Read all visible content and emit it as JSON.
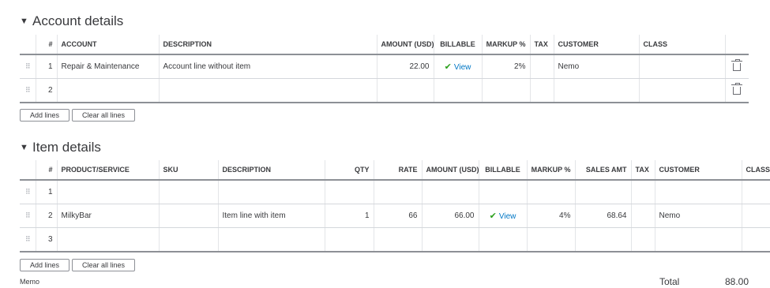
{
  "account_section": {
    "title": "Account details",
    "columns": [
      "#",
      "ACCOUNT",
      "DESCRIPTION",
      "AMOUNT (USD)",
      "BILLABLE",
      "MARKUP %",
      "TAX",
      "CUSTOMER",
      "CLASS"
    ],
    "rows": [
      {
        "num": "1",
        "account": "Repair & Maintenance",
        "description": "Account line without item",
        "amount": "22.00",
        "billable": "View",
        "markup": "2%",
        "tax": "",
        "customer": "Nemo",
        "class": ""
      },
      {
        "num": "2",
        "account": "",
        "description": "",
        "amount": "",
        "billable": "",
        "markup": "",
        "tax": "",
        "customer": "",
        "class": ""
      }
    ],
    "add_lines_label": "Add lines",
    "clear_lines_label": "Clear all lines"
  },
  "item_section": {
    "title": "Item details",
    "columns": [
      "#",
      "PRODUCT/SERVICE",
      "SKU",
      "DESCRIPTION",
      "QTY",
      "RATE",
      "AMOUNT (USD)",
      "BILLABLE",
      "MARKUP %",
      "SALES AMT",
      "TAX",
      "CUSTOMER",
      "CLASS"
    ],
    "rows": [
      {
        "num": "1",
        "product": "",
        "sku": "",
        "description": "",
        "qty": "",
        "rate": "",
        "amount": "",
        "billable": "",
        "markup": "",
        "sales_amt": "",
        "tax": "",
        "customer": "",
        "class": ""
      },
      {
        "num": "2",
        "product": "MilkyBar",
        "sku": "",
        "description": "Item line with item",
        "qty": "1",
        "rate": "66",
        "amount": "66.00",
        "billable": "View",
        "markup": "4%",
        "sales_amt": "68.64",
        "tax": "",
        "customer": "Nemo",
        "class": ""
      },
      {
        "num": "3",
        "product": "",
        "sku": "",
        "description": "",
        "qty": "",
        "rate": "",
        "amount": "",
        "billable": "",
        "markup": "",
        "sales_amt": "",
        "tax": "",
        "customer": "",
        "class": ""
      }
    ],
    "add_lines_label": "Add lines",
    "clear_lines_label": "Clear all lines"
  },
  "footer": {
    "memo_label": "Memo",
    "total_label": "Total",
    "total_value": "88.00"
  },
  "icons": {
    "caret": "caret-down-icon",
    "handle": "drag-handle-icon",
    "check": "checkmark-icon",
    "trash": "trash-icon"
  },
  "colors": {
    "check": "#2ca01c",
    "link": "#0077c5",
    "text": "#393a3d"
  }
}
